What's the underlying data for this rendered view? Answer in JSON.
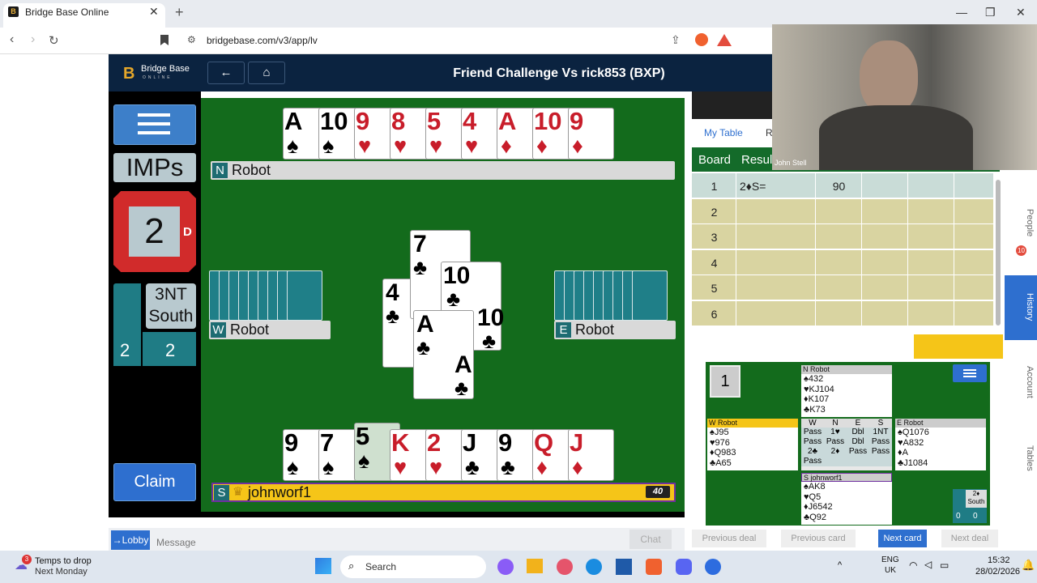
{
  "browser": {
    "tab_title": "Bridge Base Online",
    "url": "bridgebase.com/v3/app/lv"
  },
  "header": {
    "logo": "Bridge Base",
    "logo_sub": "ONLINE",
    "title": "Friend Challenge Vs rick853 (BXP)"
  },
  "left_panel": {
    "scoring": "IMPs",
    "board_number": "2",
    "dealer": "D",
    "contract_line1": "3NT",
    "contract_line2": "South",
    "tricks_ns": "2",
    "tricks_ew": "2",
    "claim_label": "Claim"
  },
  "north": {
    "seat": "N",
    "name": "Robot",
    "cards": [
      {
        "r": "A",
        "s": "♠",
        "c": "blk"
      },
      {
        "r": "10",
        "s": "♠",
        "c": "blk"
      },
      {
        "r": "9",
        "s": "♥",
        "c": "red"
      },
      {
        "r": "8",
        "s": "♥",
        "c": "red"
      },
      {
        "r": "5",
        "s": "♥",
        "c": "red"
      },
      {
        "r": "4",
        "s": "♥",
        "c": "red"
      },
      {
        "r": "A",
        "s": "♦",
        "c": "red"
      },
      {
        "r": "10",
        "s": "♦",
        "c": "red"
      },
      {
        "r": "9",
        "s": "♦",
        "c": "red"
      }
    ]
  },
  "west": {
    "seat": "W",
    "name": "Robot"
  },
  "east": {
    "seat": "E",
    "name": "Robot"
  },
  "south": {
    "seat": "S",
    "name": "johnworf1",
    "score": "40",
    "cards": [
      {
        "r": "9",
        "s": "♠",
        "c": "blk"
      },
      {
        "r": "7",
        "s": "♠",
        "c": "blk"
      },
      {
        "r": "5",
        "s": "♠",
        "c": "blk"
      },
      {
        "r": "K",
        "s": "♥",
        "c": "red"
      },
      {
        "r": "2",
        "s": "♥",
        "c": "red"
      },
      {
        "r": "J",
        "s": "♣",
        "c": "blk"
      },
      {
        "r": "9",
        "s": "♣",
        "c": "blk"
      },
      {
        "r": "Q",
        "s": "♦",
        "c": "red"
      },
      {
        "r": "J",
        "s": "♦",
        "c": "red"
      }
    ]
  },
  "trick": {
    "north": {
      "r": "7",
      "s": "♣"
    },
    "east": {
      "r": "10",
      "s": "♣"
    },
    "west": {
      "r": "4",
      "s": "♣"
    },
    "south": {
      "r": "A",
      "s": "♣"
    }
  },
  "results": {
    "tab1": "My Table",
    "tab2": "R",
    "col_board": "Board",
    "col_result": "Resul",
    "rows": [
      {
        "board": "1",
        "result": "2♦S=",
        "score": "90"
      },
      {
        "board": "2",
        "result": "",
        "score": ""
      },
      {
        "board": "3",
        "result": "",
        "score": ""
      },
      {
        "board": "4",
        "result": "",
        "score": ""
      },
      {
        "board": "5",
        "result": "",
        "score": ""
      },
      {
        "board": "6",
        "result": "",
        "score": ""
      }
    ]
  },
  "webcam": {
    "name": "John Stell"
  },
  "side_nav": [
    "People",
    "History",
    "Account",
    "Tables"
  ],
  "mini_deal": {
    "board": "1",
    "dealer": "D",
    "north": {
      "seat": "N",
      "name": "Robot",
      "lines": [
        "♠432",
        "♥KJ104",
        "♦K107",
        "♣K73"
      ]
    },
    "west": {
      "seat": "W",
      "name": "Robot",
      "lines": [
        "♠J95",
        "♥976",
        "♦Q983",
        "♣A65"
      ]
    },
    "east": {
      "seat": "E",
      "name": "Robot",
      "lines": [
        "♠Q1076",
        "♥A832",
        "♦A",
        "♣J1084"
      ]
    },
    "south": {
      "seat": "S",
      "name": "johnworf1",
      "lines": [
        "♠AK8",
        "♥Q5",
        "♦J6542",
        "♣Q92"
      ]
    },
    "bid_head": [
      "W",
      "N",
      "E",
      "S"
    ],
    "bids": [
      [
        "Pass",
        "1♥",
        "Dbl",
        "1NT"
      ],
      [
        "Pass",
        "Pass",
        "Dbl",
        "Pass"
      ],
      [
        "2♣",
        "2♦",
        "Pass",
        "Pass"
      ],
      [
        "Pass",
        "",
        "",
        ""
      ]
    ],
    "contract": "2♦",
    "declarer": "South",
    "tricks_ns": "0",
    "tricks_ew": "0"
  },
  "footer_buttons": [
    "Previous deal",
    "Previous card",
    "Next card",
    "Next deal"
  ],
  "chat": {
    "lobby": "→Lobby",
    "placeholder": "Message",
    "send": "Chat"
  },
  "taskbar": {
    "weather1": "Temps to drop",
    "weather2": "Next Monday",
    "search": "Search",
    "lang1": "ENG",
    "lang2": "UK",
    "time": "15:32",
    "date": "28/02/2026",
    "badge": "3"
  }
}
